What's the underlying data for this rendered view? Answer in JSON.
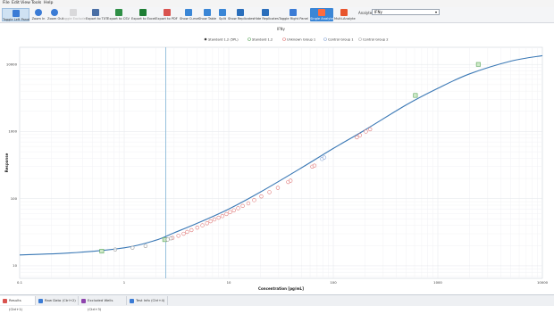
{
  "menu": [
    "File",
    "Edit",
    "View",
    "Tools",
    "Help"
  ],
  "toolbar": {
    "buttons": [
      {
        "label": "Toggle Left Panel",
        "icon": "left-panel-icon",
        "color": "#3a7bd5",
        "active": true
      },
      {
        "label": "Zoom In",
        "icon": "zoom-in-icon",
        "color": "#3a7bd5"
      },
      {
        "label": "Zoom Out",
        "icon": "zoom-out-icon",
        "color": "#3a7bd5"
      },
      {
        "label": "Toggle Exclude",
        "icon": "exclude-icon",
        "color": "#b9b9b9",
        "disabled": true
      },
      {
        "label": "Export to TXT",
        "icon": "txt-icon",
        "color": "#4a6fa5"
      },
      {
        "label": "Export to CSV",
        "icon": "csv-icon",
        "color": "#2f8f46"
      },
      {
        "label": "Export to Excel",
        "icon": "excel-icon",
        "color": "#1e7e34"
      },
      {
        "label": "Export to PDF",
        "icon": "pdf-icon",
        "color": "#d9534f"
      },
      {
        "label": "Show Curve",
        "icon": "curve-icon",
        "color": "#3a86d6"
      },
      {
        "label": "Show Table",
        "icon": "table-icon",
        "color": "#3a86d6"
      },
      {
        "label": "Split",
        "icon": "split-icon",
        "color": "#3a86d6"
      },
      {
        "label": "Show Replicates",
        "icon": "replicates-down-icon",
        "color": "#2a6ebb"
      },
      {
        "label": "Hide Replicates",
        "icon": "replicates-right-icon",
        "color": "#2a6ebb"
      },
      {
        "label": "Toggle Right Panel",
        "icon": "right-panel-icon",
        "color": "#3a7bd5"
      },
      {
        "label": "Single Analyte",
        "icon": "single-analyte-icon",
        "color": "#e8552d",
        "selected": true
      },
      {
        "label": "Multi-Analyte",
        "icon": "multi-analyte-icon",
        "color": "#e8552d"
      }
    ],
    "analyte_label": "Analyte:",
    "analyte_value": "IFNγ"
  },
  "tabs": [
    {
      "label": "Results (Ctrl+1)",
      "icon": "results-icon",
      "color": "#d9534f",
      "active": true
    },
    {
      "label": "Raw Data (Ctrl+2)",
      "icon": "raw-data-icon",
      "color": "#3a7bd5"
    },
    {
      "label": "Excluded Wells (Ctrl+3)",
      "icon": "excluded-wells-icon",
      "color": "#8e44ad"
    },
    {
      "label": "Test Info (Ctrl+4)",
      "icon": "test-info-icon",
      "color": "#3a7bd5"
    }
  ],
  "chart_data": {
    "type": "scatter",
    "title": "IFNγ",
    "xlabel": "Concentration [pg/mL]",
    "ylabel": "Response",
    "x_scale": "log",
    "y_scale": "log",
    "xlim": [
      0.1,
      10000
    ],
    "ylim": [
      6.5,
      18000
    ],
    "x_ticks": [
      "0.1",
      "1",
      "10",
      "100",
      "1000",
      "10000"
    ],
    "x_tick_values": [
      0.1,
      1,
      10,
      100,
      1000,
      10000
    ],
    "y_ticks": [
      "10",
      "100",
      "1000",
      "10000"
    ],
    "y_tick_values": [
      10,
      100,
      1000,
      10000
    ],
    "grid": true,
    "legend_position": "top-center",
    "legend": [
      {
        "name": "Standard 1.2 (5PL)",
        "marker": "dot",
        "color": "#3a3a3a"
      },
      {
        "name": "Standard 1.2",
        "marker": "circle",
        "color": "#5ba55b"
      },
      {
        "name": "Unknown Group 1",
        "marker": "circle",
        "color": "#e07b7b"
      },
      {
        "name": "Control Group 1",
        "marker": "circle",
        "color": "#8aa6d6"
      },
      {
        "name": "Control Group 2",
        "marker": "circle",
        "color": "#b0b0b0"
      }
    ],
    "vertical_line_x": 2.5,
    "curve": [
      [
        0.1,
        14.5
      ],
      [
        0.3,
        15.5
      ],
      [
        1,
        18.5
      ],
      [
        2,
        24
      ],
      [
        3,
        31
      ],
      [
        5,
        43
      ],
      [
        10,
        70
      ],
      [
        20,
        125
      ],
      [
        50,
        290
      ],
      [
        100,
        560
      ],
      [
        200,
        1050
      ],
      [
        500,
        2500
      ],
      [
        1000,
        4400
      ],
      [
        2000,
        7200
      ],
      [
        5000,
        11200
      ],
      [
        10000,
        13500
      ]
    ],
    "series": [
      {
        "name": "Standard 1.2",
        "marker": "square",
        "color": "#5ba55b",
        "x": [
          0.61,
          2.44,
          610,
          2440
        ],
        "y": [
          16.5,
          24.5,
          3450,
          10000
        ]
      },
      {
        "name": "Unknown Group 1",
        "marker": "circle",
        "color": "#e07b7b",
        "x": [
          2.9,
          3.3,
          3.7,
          4.0,
          4.4,
          5.0,
          5.6,
          6.2,
          6.7,
          7.3,
          8.0,
          8.7,
          9.5,
          10.3,
          11.2,
          12.3,
          13.6,
          15.4,
          17.5,
          20.5,
          24.5,
          29.5,
          37,
          39,
          63,
          66,
          168,
          180,
          205,
          225
        ],
        "y": [
          26,
          28,
          30,
          32,
          34,
          37,
          40,
          43,
          46,
          49,
          52,
          55,
          59,
          63,
          67,
          72,
          78,
          85,
          95,
          108,
          125,
          145,
          177,
          185,
          300,
          310,
          820,
          880,
          1000,
          1080
        ]
      },
      {
        "name": "Control Group 1",
        "marker": "circle",
        "color": "#8aa6d6",
        "x": [
          78,
          82
        ],
        "y": [
          390,
          410
        ]
      },
      {
        "name": "Control Group 2",
        "marker": "circle",
        "color": "#9a9a9a",
        "x": [
          0.82,
          1.2,
          1.6,
          2.6,
          2.8
        ],
        "y": [
          17.5,
          18.6,
          19.7,
          24.6,
          25.6
        ]
      }
    ]
  }
}
